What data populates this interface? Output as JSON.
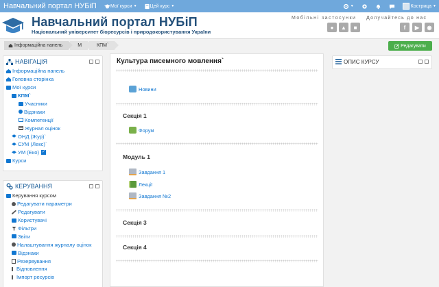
{
  "topbar": {
    "brand": "Навчальний портал НУБіП",
    "menus": [
      {
        "label": "Мої курси"
      },
      {
        "label": "Цей курс"
      }
    ],
    "user_name": "Кострица"
  },
  "header": {
    "title": "Навчальний портал НУБіП",
    "subtitle": "Національний університет біоресурсів і природокористування України",
    "apps_label": "Мобільні застосунки",
    "join_label": "Долучайтесь до нас"
  },
  "breadcrumb": [
    "Інформаційна панель",
    "М",
    "КПМ`"
  ],
  "edit_button": "Редагувати",
  "navigation": {
    "title": "НАВІГАЦІЯ",
    "items": [
      {
        "label": "Інформаційна панель",
        "level": 0,
        "icon": "home-icon"
      },
      {
        "label": "Головна сторінка",
        "level": 0,
        "icon": "home-icon"
      },
      {
        "label": "Мої курси",
        "level": 0,
        "icon": "folder-icon"
      },
      {
        "label": "КПМ`",
        "level": 1,
        "icon": "folder-icon",
        "bold": true
      },
      {
        "label": "Учасники",
        "level": 2,
        "icon": "folder-icon"
      },
      {
        "label": "Відзнаки",
        "level": 2,
        "icon": "badge-icon"
      },
      {
        "label": "Компетенції",
        "level": 2,
        "icon": "checkbox-icon"
      },
      {
        "label": "Журнал оцінок",
        "level": 2,
        "icon": "table-icon"
      },
      {
        "label": "ОНД (Жур)`",
        "level": 1,
        "icon": "graduation-cap-icon"
      },
      {
        "label": "СУМ (Лекс)`",
        "level": 1,
        "icon": "graduation-cap-icon"
      },
      {
        "label": "УМ (Еко)",
        "level": 1,
        "icon": "graduation-cap-icon"
      },
      {
        "label": "Курси",
        "level": 0,
        "icon": "folder-icon"
      }
    ]
  },
  "admin": {
    "title": "КЕРУВАННЯ",
    "items": [
      {
        "label": "Керування курсом",
        "level": 0
      },
      {
        "label": "Редагувати параметри",
        "level": 1
      },
      {
        "label": "Редагувати",
        "level": 1
      },
      {
        "label": "Користувачі",
        "level": 1
      },
      {
        "label": "Фільтри",
        "level": 1
      },
      {
        "label": "Звіти",
        "level": 1
      },
      {
        "label": "Налаштування журналу оцінок",
        "level": 1
      },
      {
        "label": "Відзнаки",
        "level": 1
      },
      {
        "label": "Резервування",
        "level": 1
      },
      {
        "label": "Відновлення",
        "level": 1
      },
      {
        "label": "Імпорт ресурсів",
        "level": 1
      }
    ]
  },
  "course": {
    "title": "Культура писемного мовлення`",
    "news": "Новини",
    "sections": [
      {
        "title": "Секція 1",
        "activities": [
          "Форум"
        ]
      },
      {
        "title": "Модуль 1",
        "activities": [
          "Завдання 1",
          "Лекції",
          "Завдання №2"
        ]
      },
      {
        "title": "Секція 3",
        "activities": []
      },
      {
        "title": "Секція 4",
        "activities": []
      }
    ]
  },
  "course_desc": {
    "title": "ОПИС КУРСУ"
  },
  "colors": {
    "navbar": "#6fa8dc",
    "brand_text": "#23507a",
    "link": "#1177d1",
    "edit_button": "#4cae4c"
  }
}
